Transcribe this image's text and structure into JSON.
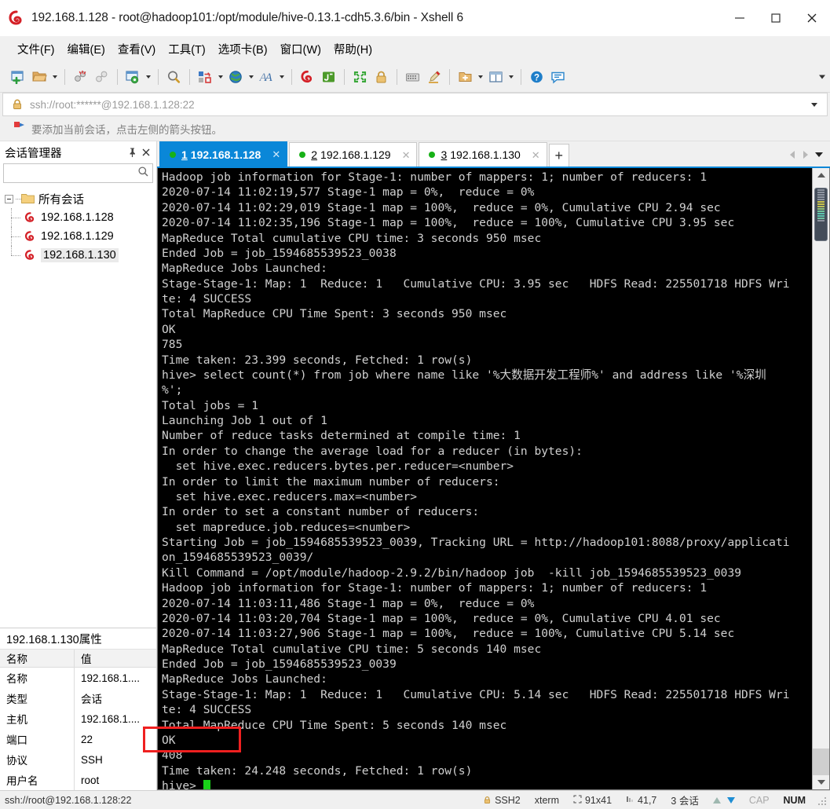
{
  "window": {
    "title": "192.168.1.128 - root@hadoop101:/opt/module/hive-0.13.1-cdh5.3.6/bin - Xshell 6",
    "app_icon": "xshell-icon",
    "minimize_label": "─",
    "maximize_label": "□",
    "close_label": "✕"
  },
  "menubar": {
    "items": [
      {
        "label": "文件(F)",
        "name": "menu-file"
      },
      {
        "label": "编辑(E)",
        "name": "menu-edit"
      },
      {
        "label": "查看(V)",
        "name": "menu-view"
      },
      {
        "label": "工具(T)",
        "name": "menu-tools"
      },
      {
        "label": "选项卡(B)",
        "name": "menu-tabs"
      },
      {
        "label": "窗口(W)",
        "name": "menu-window"
      },
      {
        "label": "帮助(H)",
        "name": "menu-help"
      }
    ]
  },
  "toolbar": {
    "icons": [
      "new-session-icon",
      "open-folder-icon",
      "disconnect-icon",
      "link-icon",
      "session-properties-icon",
      "find-icon",
      "transfer-icon",
      "globe-icon",
      "font-icon",
      "xshell-icon",
      "xftp-icon",
      "fullscreen-icon",
      "lock-icon",
      "keyboard-icon",
      "highlight-icon",
      "new-folder-icon",
      "layout-icon",
      "help-icon",
      "feedback-icon"
    ]
  },
  "address_bar": {
    "value": "ssh://root:******@192.168.1.128:22",
    "lock_icon": "lock-icon",
    "dropdown_icon": "chevron-down-icon"
  },
  "notice_bar": {
    "icon": "red-flag-icon",
    "text": "要添加当前会话，点击左侧的箭头按钮。"
  },
  "sidebar": {
    "title": "会话管理器",
    "pin_icon": "pin-icon",
    "close_icon": "close-icon",
    "search_placeholder": "",
    "search_icon": "search-icon",
    "tree": {
      "root_label": "所有会话",
      "root_icon": "folder-icon",
      "children": [
        {
          "label": "192.168.1.128",
          "icon": "xshell-session-icon",
          "selected": false
        },
        {
          "label": "192.168.1.129",
          "icon": "xshell-session-icon",
          "selected": false
        },
        {
          "label": "192.168.1.130",
          "icon": "xshell-session-icon",
          "selected": true
        }
      ]
    }
  },
  "properties": {
    "title": "192.168.1.130属性",
    "columns": [
      "名称",
      "值"
    ],
    "rows": [
      {
        "name": "名称",
        "value": "192.168.1...."
      },
      {
        "name": "类型",
        "value": "会话"
      },
      {
        "name": "主机",
        "value": "192.168.1...."
      },
      {
        "name": "端口",
        "value": "22"
      },
      {
        "name": "协议",
        "value": "SSH"
      },
      {
        "name": "用户名",
        "value": "root"
      }
    ]
  },
  "tabs": {
    "items": [
      {
        "num": "1",
        "label": "192.168.1.128",
        "active": true,
        "status": "connected"
      },
      {
        "num": "2",
        "label": "192.168.1.129",
        "active": false,
        "status": "connected"
      },
      {
        "num": "3",
        "label": "192.168.1.130",
        "active": false,
        "status": "connected"
      }
    ],
    "add_label": "+",
    "scroll_left_icon": "chevron-left-icon",
    "scroll_right_icon": "chevron-right-icon",
    "list_icon": "chevron-down-icon"
  },
  "terminal": {
    "lines": [
      "Hadoop job information for Stage-1: number of mappers: 1; number of reducers: 1",
      "2020-07-14 11:02:19,577 Stage-1 map = 0%,  reduce = 0%",
      "2020-07-14 11:02:29,019 Stage-1 map = 100%,  reduce = 0%, Cumulative CPU 2.94 sec",
      "2020-07-14 11:02:35,196 Stage-1 map = 100%,  reduce = 100%, Cumulative CPU 3.95 sec",
      "MapReduce Total cumulative CPU time: 3 seconds 950 msec",
      "Ended Job = job_1594685539523_0038",
      "MapReduce Jobs Launched:",
      "Stage-Stage-1: Map: 1  Reduce: 1   Cumulative CPU: 3.95 sec   HDFS Read: 225501718 HDFS Wri",
      "te: 4 SUCCESS",
      "Total MapReduce CPU Time Spent: 3 seconds 950 msec",
      "OK",
      "785",
      "Time taken: 23.399 seconds, Fetched: 1 row(s)",
      "hive> select count(*) from job where name like '%大数据开发工程师%' and address like '%深圳",
      "%';",
      "Total jobs = 1",
      "Launching Job 1 out of 1",
      "Number of reduce tasks determined at compile time: 1",
      "In order to change the average load for a reducer (in bytes):",
      "  set hive.exec.reducers.bytes.per.reducer=<number>",
      "In order to limit the maximum number of reducers:",
      "  set hive.exec.reducers.max=<number>",
      "In order to set a constant number of reducers:",
      "  set mapreduce.job.reduces=<number>",
      "Starting Job = job_1594685539523_0039, Tracking URL = http://hadoop101:8088/proxy/applicati",
      "on_1594685539523_0039/",
      "Kill Command = /opt/module/hadoop-2.9.2/bin/hadoop job  -kill job_1594685539523_0039",
      "Hadoop job information for Stage-1: number of mappers: 1; number of reducers: 1",
      "2020-07-14 11:03:11,486 Stage-1 map = 0%,  reduce = 0%",
      "2020-07-14 11:03:20,704 Stage-1 map = 100%,  reduce = 0%, Cumulative CPU 4.01 sec",
      "2020-07-14 11:03:27,906 Stage-1 map = 100%,  reduce = 100%, Cumulative CPU 5.14 sec",
      "MapReduce Total cumulative CPU time: 5 seconds 140 msec",
      "Ended Job = job_1594685539523_0039",
      "MapReduce Jobs Launched:",
      "Stage-Stage-1: Map: 1  Reduce: 1   Cumulative CPU: 5.14 sec   HDFS Read: 225501718 HDFS Wri",
      "te: 4 SUCCESS",
      "Total MapReduce CPU Time Spent: 5 seconds 140 msec",
      "OK",
      "408",
      "Time taken: 24.248 seconds, Fetched: 1 row(s)",
      "hive> "
    ],
    "prompt": "hive>",
    "highlighted_value": "408",
    "fg_color": "#d0d0d0",
    "bg_color": "#000000",
    "cursor_color": "#19d219",
    "highlight_box_color": "#ef2020"
  },
  "statusbar": {
    "connection": "ssh://root@192.168.1.128:22",
    "protocol": "SSH2",
    "terminal_type": "xterm",
    "size": "91x41",
    "cursor_pos": "41,7",
    "sessions": "3 会话",
    "caps": "CAP",
    "num": "NUM",
    "lock_icon": "lock-icon",
    "upload_icon": "arrow-up-icon",
    "download_icon": "arrow-down-icon",
    "resize_grip_icon": "resize-grip-icon"
  }
}
